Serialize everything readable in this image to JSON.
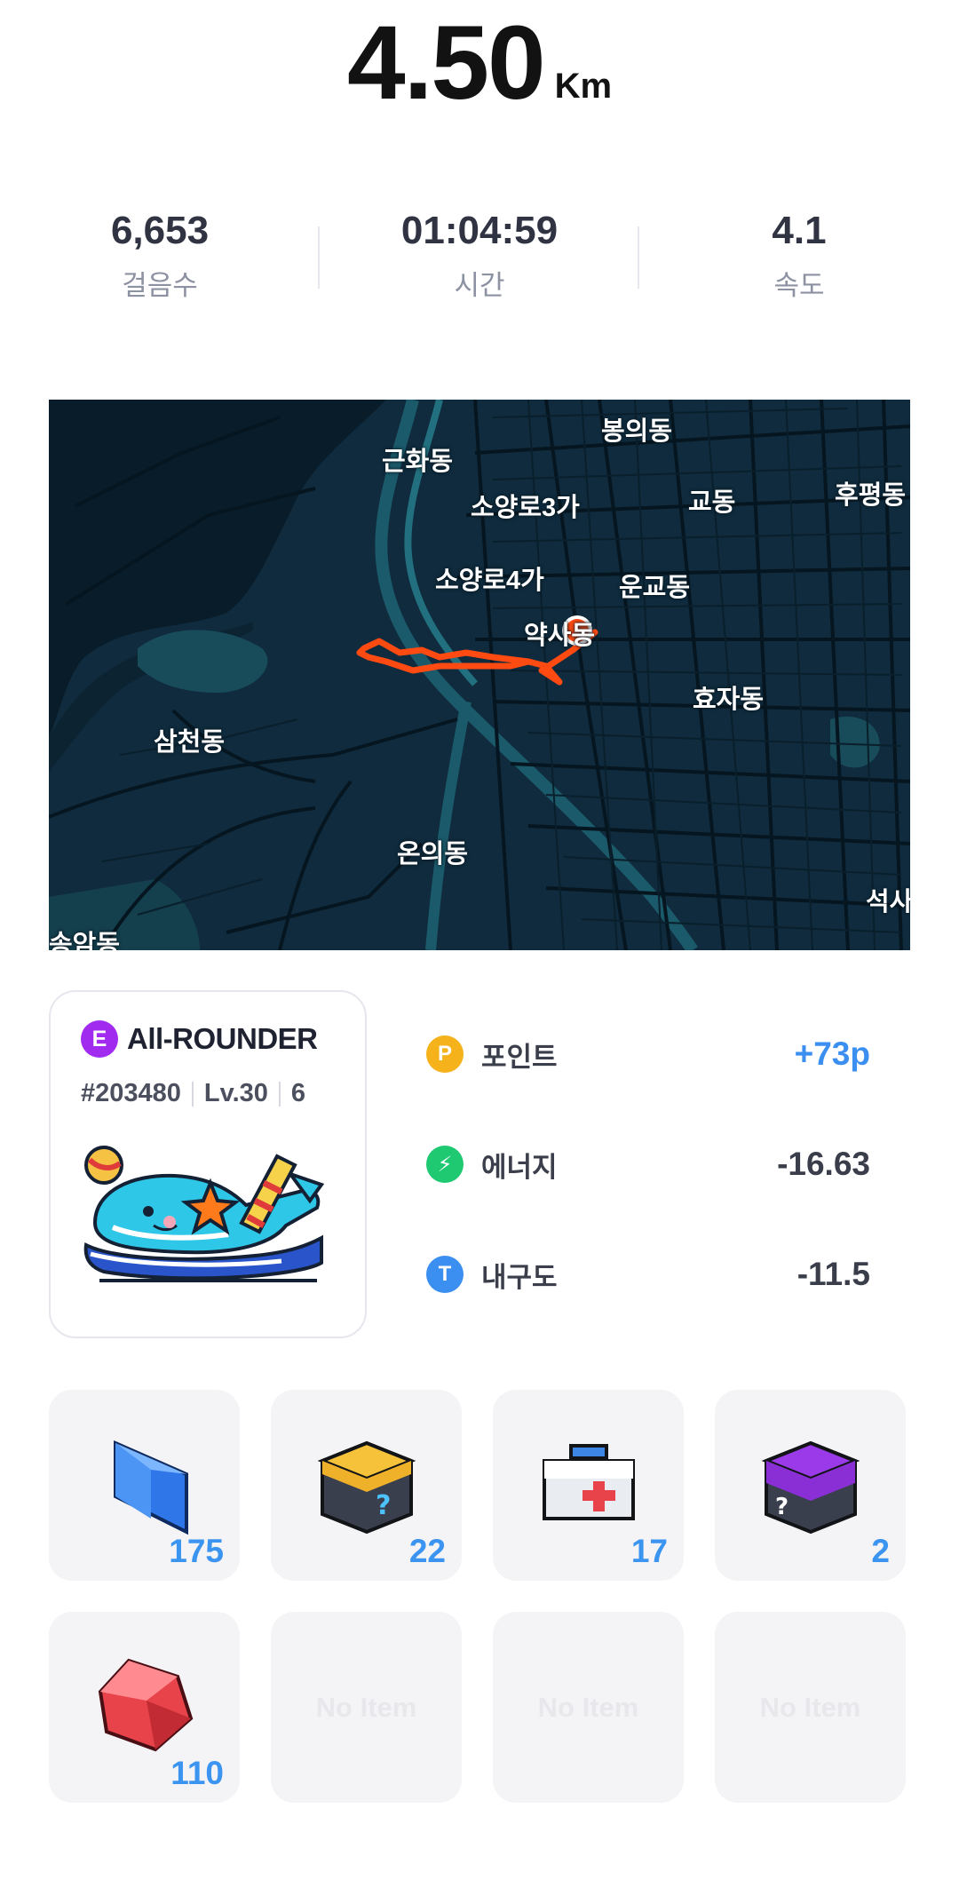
{
  "distance": {
    "value": "4.50",
    "unit": "Km"
  },
  "stats": [
    {
      "value": "6,653",
      "label": "걸음수"
    },
    {
      "value": "01:04:59",
      "label": "시간"
    },
    {
      "value": "4.1",
      "label": "속도"
    }
  ],
  "map": {
    "labels": [
      "봉의동",
      "근화동",
      "소양로3가",
      "교동",
      "후평동",
      "소양로4가",
      "운교동",
      "약사동",
      "효자동",
      "삼천동",
      "온의동",
      "석사",
      "송암동"
    ],
    "route_color": "#ff4a12"
  },
  "nft": {
    "grade_badge": "E",
    "name": "All-ROUNDER",
    "id": "#203480",
    "level": "Lv.30",
    "extra": "6"
  },
  "rewards": [
    {
      "icon": "point-icon",
      "icon_text": "P",
      "label": "포인트",
      "value": "+73p",
      "color": "#f5b21b",
      "value_color": "#3b8ff0"
    },
    {
      "icon": "energy-icon",
      "icon_text": "⚡",
      "label": "에너지",
      "value": "-16.63",
      "color": "#1ec972",
      "value_color": "#3a3e4b"
    },
    {
      "icon": "durability-icon",
      "icon_text": "T",
      "label": "내구도",
      "value": "-11.5",
      "color": "#3b8ff0",
      "value_color": "#3a3e4b"
    }
  ],
  "items": [
    {
      "name": "blue-crystal",
      "count": "175"
    },
    {
      "name": "yellow-mystery-box",
      "count": "22"
    },
    {
      "name": "repair-kit",
      "count": "17"
    },
    {
      "name": "purple-mystery-box",
      "count": "2"
    },
    {
      "name": "red-gem",
      "count": "110"
    },
    {
      "empty": "No Item"
    },
    {
      "empty": "No Item"
    },
    {
      "empty": "No Item"
    }
  ]
}
